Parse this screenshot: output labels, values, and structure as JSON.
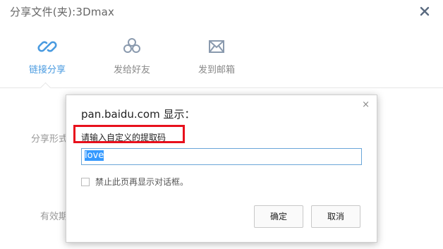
{
  "share": {
    "title": "分享文件(夹):3Dmax",
    "tabs": [
      {
        "label": "链接分享",
        "icon": "link-icon",
        "active": true
      },
      {
        "label": "发给好友",
        "icon": "friends-icon",
        "active": false
      },
      {
        "label": "发到邮箱",
        "icon": "email-icon",
        "active": false
      }
    ],
    "form_labels": {
      "share_form": "分享形式",
      "validity": "有效期"
    }
  },
  "prompt": {
    "origin": "pan.baidu.com 显示：",
    "message": "请输入自定义的提取码",
    "input_value": "love",
    "checkbox_label": "禁止此页再显示对话框。",
    "ok_label": "确定",
    "cancel_label": "取消",
    "close_glyph": "×"
  },
  "colors": {
    "accent": "#4a9be0",
    "highlight": "#e8101c"
  }
}
